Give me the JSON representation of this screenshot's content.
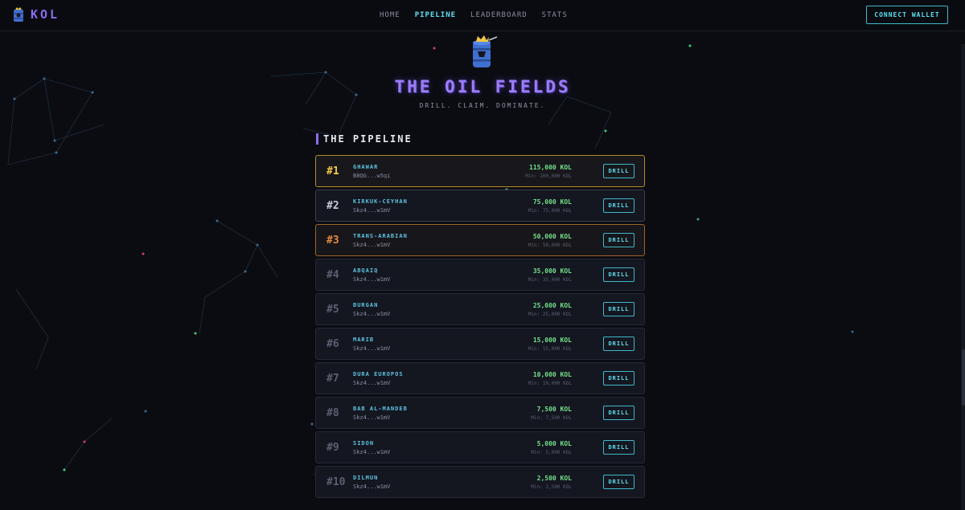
{
  "nav": {
    "logo_text": "KOL",
    "links": [
      "HOME",
      "PIPELINE",
      "LEADERBOARD",
      "STATS"
    ],
    "active_link": "PIPELINE",
    "connect_label": "CONNECT WALLET"
  },
  "hero": {
    "title": "THE OIL FIELDS",
    "subtitle": "DRILL. CLAIM. DOMINATE."
  },
  "pipeline": {
    "title": "THE PIPELINE",
    "drill_label": "DRILL",
    "rows": [
      {
        "rank": "#1",
        "name": "GHAWAR",
        "addr": "B8QG...w5qi",
        "amount": "115,000 KOL",
        "min": "Min: 100,000 KOL",
        "tier": "gold"
      },
      {
        "rank": "#2",
        "name": "KIRKUK-CEYHAN",
        "addr": "Skz4...w1mV",
        "amount": "75,000 KOL",
        "min": "Min: 75,000 KOL",
        "tier": "silver"
      },
      {
        "rank": "#3",
        "name": "TRANS-ARABIAN",
        "addr": "Skz4...w1mV",
        "amount": "50,000 KOL",
        "min": "Min: 50,000 KOL",
        "tier": "bronze"
      },
      {
        "rank": "#4",
        "name": "ABQAIQ",
        "addr": "Skz4...w1mV",
        "amount": "35,000 KOL",
        "min": "Min: 35,000 KOL",
        "tier": ""
      },
      {
        "rank": "#5",
        "name": "BURGAN",
        "addr": "Skz4...w1mV",
        "amount": "25,000 KOL",
        "min": "Min: 25,000 KOL",
        "tier": ""
      },
      {
        "rank": "#6",
        "name": "MARIB",
        "addr": "Skz4...w1mV",
        "amount": "15,000 KOL",
        "min": "Min: 15,000 KOL",
        "tier": ""
      },
      {
        "rank": "#7",
        "name": "DURA EUROPOS",
        "addr": "Skz4...w1mV",
        "amount": "10,000 KOL",
        "min": "Min: 10,000 KOL",
        "tier": ""
      },
      {
        "rank": "#8",
        "name": "BAB AL-MANDEB",
        "addr": "Skz4...w1mV",
        "amount": "7,500 KOL",
        "min": "Min: 7,500 KOL",
        "tier": ""
      },
      {
        "rank": "#9",
        "name": "SIDON",
        "addr": "Skz4...w1mV",
        "amount": "5,000 KOL",
        "min": "Min: 5,000 KOL",
        "tier": ""
      },
      {
        "rank": "#10",
        "name": "DILMUN",
        "addr": "Skz4...w1mV",
        "amount": "2,500 KOL",
        "min": "Min: 2,500 KOL",
        "tier": ""
      }
    ]
  },
  "colors": {
    "accent": "#5ee0ef",
    "brand": "#8a6cf0",
    "gold": "#f2c744",
    "bronze": "#e08a3c",
    "amount": "#74e08a"
  }
}
